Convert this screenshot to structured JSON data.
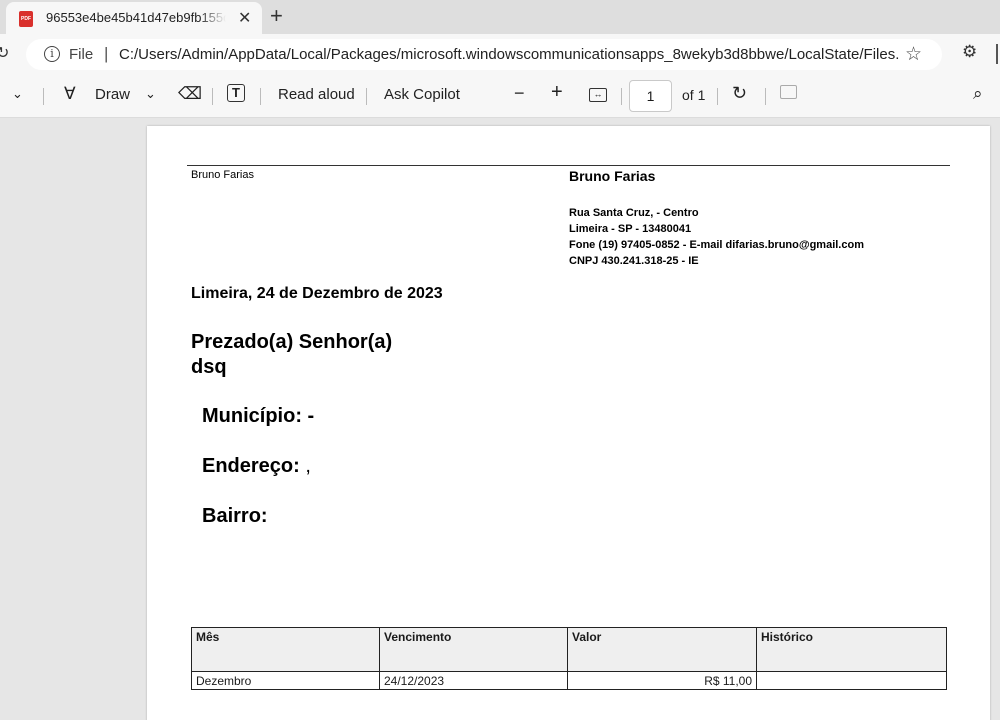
{
  "browser": {
    "tab_title": "96553e4be45b41d47eb9fb155dc",
    "tab_icon_text": "PDF",
    "address_prefix": "File",
    "url": "C:/Users/Admin/AppData/Local/Packages/microsoft.windowscommunicationsapps_8wekyb3d8bbwe/LocalState/Files..."
  },
  "toolbar": {
    "draw_label": "Draw",
    "read_aloud_label": "Read aloud",
    "ask_copilot_label": "Ask Copilot",
    "page_number": "1",
    "page_of": "of 1"
  },
  "document": {
    "sender_left": "Bruno Farias",
    "sender_name": "Bruno Farias",
    "address_lines": [
      "Rua Santa Cruz, - Centro",
      "Limeira - SP - 13480041",
      "Fone (19) 97405-0852 - E-mail difarias.bruno@gmail.com",
      "CNPJ 430.241.318-25 - IE"
    ],
    "date_line": "Limeira, 24 de Dezembro de 2023",
    "greeting": "Prezado(a) Senhor(a)",
    "recipient": "dsq",
    "fields": [
      {
        "label": "Município:",
        "value": "-"
      },
      {
        "label": "Endereço:",
        "value": ","
      },
      {
        "label": "Bairro:",
        "value": ""
      }
    ],
    "table": {
      "headers": [
        "Mês",
        "Vencimento",
        "Valor",
        "Histórico"
      ],
      "rows": [
        [
          "Dezembro",
          "24/12/2023",
          "R$ 11,00",
          ""
        ]
      ]
    }
  }
}
